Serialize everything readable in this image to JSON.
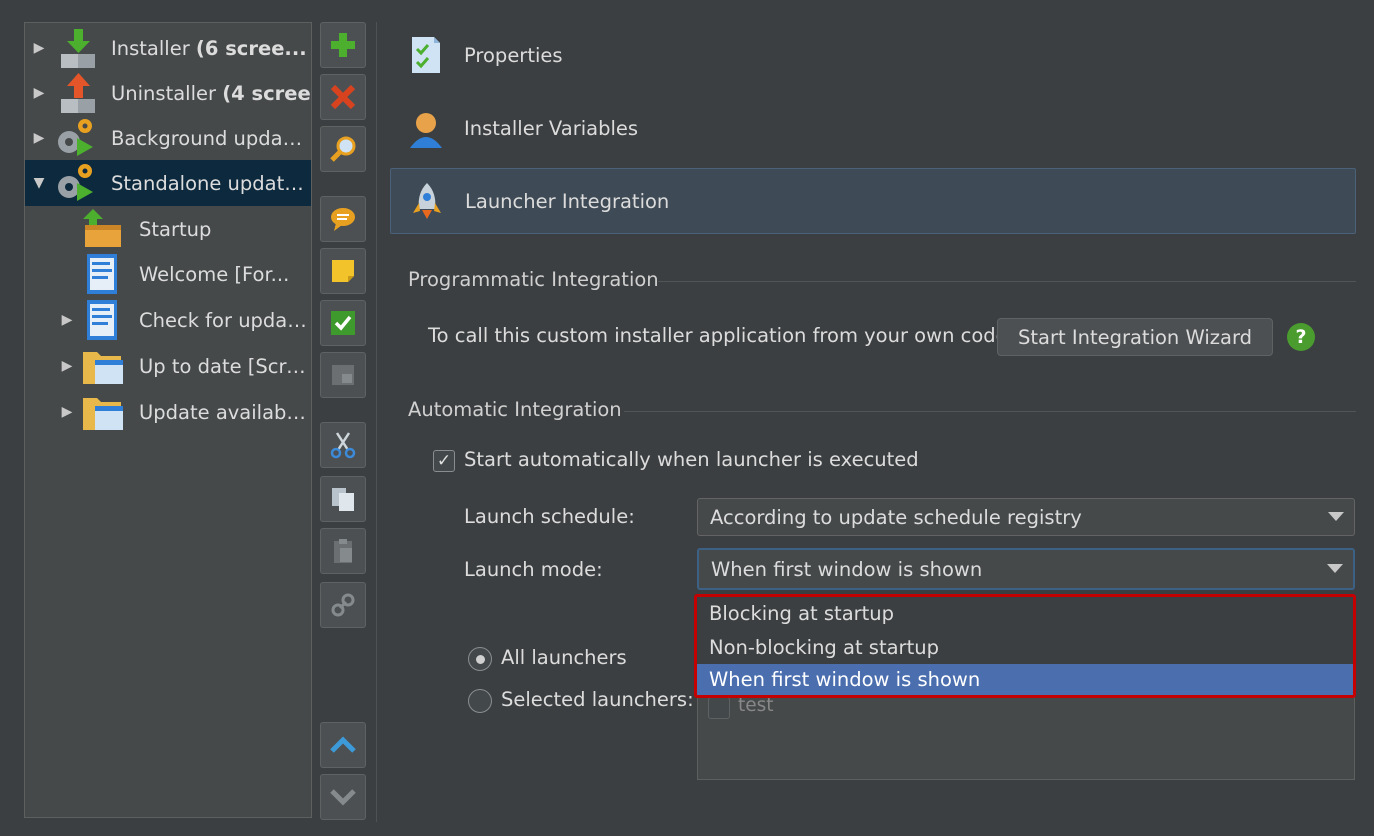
{
  "tree": {
    "items": [
      {
        "label": "Installer ",
        "bold": "(6 scree...",
        "expanded": false,
        "icon": "download-arrow-icon"
      },
      {
        "label": "Uninstaller ",
        "bold": "(4 scree...",
        "expanded": false,
        "icon": "upload-arrow-icon"
      },
      {
        "label": "Background update...",
        "bold": "",
        "expanded": false,
        "icon": "gears-play-icon"
      },
      {
        "label": "Standalone update ...",
        "bold": "",
        "expanded": true,
        "icon": "gears-play-icon"
      },
      {
        "label": "Startup",
        "icon": "startup-box-icon"
      },
      {
        "label": "Welcome [For...",
        "icon": "screen-icon"
      },
      {
        "label": "Check for updat...",
        "icon": "screen-icon"
      },
      {
        "label": "Up to date [Scre...",
        "icon": "folder-window-icon"
      },
      {
        "label": "Update available...",
        "icon": "folder-window-icon"
      }
    ],
    "arrow_collapsed": "▶",
    "arrow_expanded": "▼"
  },
  "toolbar": {
    "buttons": [
      {
        "name": "add-icon"
      },
      {
        "name": "delete-icon"
      },
      {
        "name": "search-icon"
      },
      {
        "name": "comment-icon"
      },
      {
        "name": "note-icon"
      },
      {
        "name": "check-icon"
      },
      {
        "name": "folder-icon"
      },
      {
        "name": "cut-icon"
      },
      {
        "name": "copy-icon"
      },
      {
        "name": "paste-icon"
      },
      {
        "name": "link-icon"
      },
      {
        "name": "move-up-icon"
      },
      {
        "name": "move-down-icon"
      }
    ]
  },
  "nav": {
    "properties": "Properties",
    "variables": "Installer Variables",
    "launcher": "Launcher Integration"
  },
  "programmatic": {
    "title": "Programmatic Integration",
    "text": "To call this custom installer application from your own code:",
    "button": "Start Integration Wizard",
    "help": "?"
  },
  "automatic": {
    "title": "Automatic Integration",
    "checkbox_label": "Start automatically when launcher is executed",
    "checkbox_checked": "✓",
    "schedule_label": "Launch schedule:",
    "schedule_value": "According to update schedule registry",
    "mode_label": "Launch mode:",
    "mode_value": "When first window is shown",
    "mode_options": [
      "Blocking at startup",
      "Non-blocking at startup",
      "When first window is shown"
    ],
    "radio_all": "All launchers",
    "radio_selected": "Selected launchers:",
    "launcher_list": [
      "test"
    ]
  },
  "colors": {
    "background": "#3c3f41",
    "selection": "#0d293e",
    "popup_highlight": "#4b6eaf",
    "popup_border": "#c40000"
  }
}
